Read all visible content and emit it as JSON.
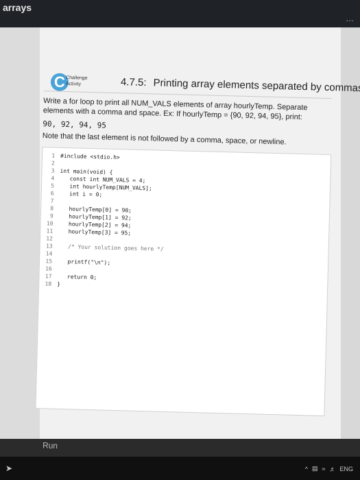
{
  "window": {
    "title": "arrays",
    "menu_dots": "…"
  },
  "activity": {
    "badge_letter": "C",
    "badge_label_1": "Challenge",
    "badge_label_2": "Activity",
    "number": "4.7.5:",
    "title": "Printing array elements separated by commas.",
    "description": "Write a for loop to print all NUM_VALS elements of array hourlyTemp. Separate elements with a comma and space. Ex: If hourlyTemp = {90, 92, 94, 95}, print:",
    "sample_output": "90, 92, 94, 95",
    "note": "Note that the last element is not followed by a comma, space, or newline."
  },
  "editor": {
    "line_numbers": [
      "1",
      "2",
      "3",
      "4",
      "5",
      "6",
      "7",
      "8",
      "9",
      "10",
      "11",
      "12",
      "13",
      "14",
      "15",
      "16",
      "17",
      "18"
    ],
    "lines": [
      "#include <stdio.h>",
      "",
      "int main(void) {",
      "   const int NUM_VALS = 4;",
      "   int hourlyTemp[NUM_VALS];",
      "   int i = 0;",
      "",
      "   hourlyTemp[0] = 90;",
      "   hourlyTemp[1] = 92;",
      "   hourlyTemp[2] = 94;",
      "   hourlyTemp[3] = 95;",
      "",
      "   /* Your solution goes here */",
      "",
      "   printf(\"\\n\");",
      "",
      "   return 0;",
      "}"
    ]
  },
  "run_button": {
    "label": "Run"
  },
  "taskbar": {
    "language": "ENG"
  }
}
